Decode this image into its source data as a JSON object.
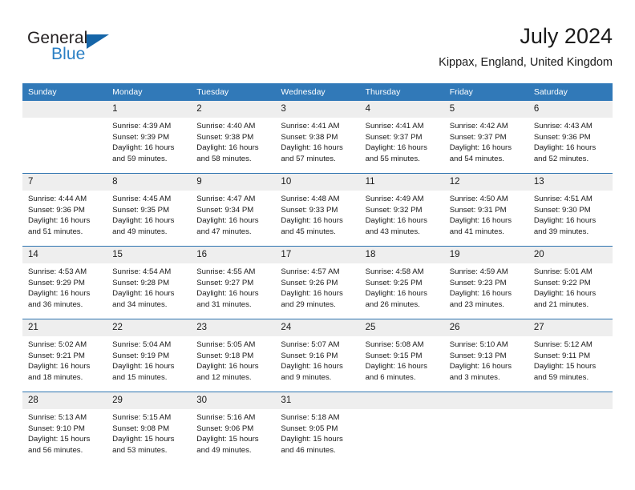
{
  "logo": {
    "word_top": "General",
    "word_bottom": "Blue",
    "triangle_color": "#1565a8",
    "blue_color": "#2a7fc4"
  },
  "header": {
    "title": "July 2024",
    "subtitle": "Kippax, England, United Kingdom"
  },
  "theme": {
    "header_blue": "#3179b8",
    "separator_blue": "#2e74b0",
    "daynum_band": "#eeeeee",
    "text": "#1a1a1a"
  },
  "weekday_headers": [
    "Sunday",
    "Monday",
    "Tuesday",
    "Wednesday",
    "Thursday",
    "Friday",
    "Saturday"
  ],
  "labels": {
    "sunrise": "Sunrise:",
    "sunset": "Sunset:",
    "daylight": "Daylight:"
  },
  "weeks": [
    [
      {
        "day": "",
        "empty": true,
        "sunrise": "",
        "sunset": "",
        "daylight_l1": "",
        "daylight_l2": ""
      },
      {
        "day": "1",
        "sunrise": "Sunrise: 4:39 AM",
        "sunset": "Sunset: 9:39 PM",
        "daylight_l1": "Daylight: 16 hours",
        "daylight_l2": "and 59 minutes."
      },
      {
        "day": "2",
        "sunrise": "Sunrise: 4:40 AM",
        "sunset": "Sunset: 9:38 PM",
        "daylight_l1": "Daylight: 16 hours",
        "daylight_l2": "and 58 minutes."
      },
      {
        "day": "3",
        "sunrise": "Sunrise: 4:41 AM",
        "sunset": "Sunset: 9:38 PM",
        "daylight_l1": "Daylight: 16 hours",
        "daylight_l2": "and 57 minutes."
      },
      {
        "day": "4",
        "sunrise": "Sunrise: 4:41 AM",
        "sunset": "Sunset: 9:37 PM",
        "daylight_l1": "Daylight: 16 hours",
        "daylight_l2": "and 55 minutes."
      },
      {
        "day": "5",
        "sunrise": "Sunrise: 4:42 AM",
        "sunset": "Sunset: 9:37 PM",
        "daylight_l1": "Daylight: 16 hours",
        "daylight_l2": "and 54 minutes."
      },
      {
        "day": "6",
        "sunrise": "Sunrise: 4:43 AM",
        "sunset": "Sunset: 9:36 PM",
        "daylight_l1": "Daylight: 16 hours",
        "daylight_l2": "and 52 minutes."
      }
    ],
    [
      {
        "day": "7",
        "sunrise": "Sunrise: 4:44 AM",
        "sunset": "Sunset: 9:36 PM",
        "daylight_l1": "Daylight: 16 hours",
        "daylight_l2": "and 51 minutes."
      },
      {
        "day": "8",
        "sunrise": "Sunrise: 4:45 AM",
        "sunset": "Sunset: 9:35 PM",
        "daylight_l1": "Daylight: 16 hours",
        "daylight_l2": "and 49 minutes."
      },
      {
        "day": "9",
        "sunrise": "Sunrise: 4:47 AM",
        "sunset": "Sunset: 9:34 PM",
        "daylight_l1": "Daylight: 16 hours",
        "daylight_l2": "and 47 minutes."
      },
      {
        "day": "10",
        "sunrise": "Sunrise: 4:48 AM",
        "sunset": "Sunset: 9:33 PM",
        "daylight_l1": "Daylight: 16 hours",
        "daylight_l2": "and 45 minutes."
      },
      {
        "day": "11",
        "sunrise": "Sunrise: 4:49 AM",
        "sunset": "Sunset: 9:32 PM",
        "daylight_l1": "Daylight: 16 hours",
        "daylight_l2": "and 43 minutes."
      },
      {
        "day": "12",
        "sunrise": "Sunrise: 4:50 AM",
        "sunset": "Sunset: 9:31 PM",
        "daylight_l1": "Daylight: 16 hours",
        "daylight_l2": "and 41 minutes."
      },
      {
        "day": "13",
        "sunrise": "Sunrise: 4:51 AM",
        "sunset": "Sunset: 9:30 PM",
        "daylight_l1": "Daylight: 16 hours",
        "daylight_l2": "and 39 minutes."
      }
    ],
    [
      {
        "day": "14",
        "sunrise": "Sunrise: 4:53 AM",
        "sunset": "Sunset: 9:29 PM",
        "daylight_l1": "Daylight: 16 hours",
        "daylight_l2": "and 36 minutes."
      },
      {
        "day": "15",
        "sunrise": "Sunrise: 4:54 AM",
        "sunset": "Sunset: 9:28 PM",
        "daylight_l1": "Daylight: 16 hours",
        "daylight_l2": "and 34 minutes."
      },
      {
        "day": "16",
        "sunrise": "Sunrise: 4:55 AM",
        "sunset": "Sunset: 9:27 PM",
        "daylight_l1": "Daylight: 16 hours",
        "daylight_l2": "and 31 minutes."
      },
      {
        "day": "17",
        "sunrise": "Sunrise: 4:57 AM",
        "sunset": "Sunset: 9:26 PM",
        "daylight_l1": "Daylight: 16 hours",
        "daylight_l2": "and 29 minutes."
      },
      {
        "day": "18",
        "sunrise": "Sunrise: 4:58 AM",
        "sunset": "Sunset: 9:25 PM",
        "daylight_l1": "Daylight: 16 hours",
        "daylight_l2": "and 26 minutes."
      },
      {
        "day": "19",
        "sunrise": "Sunrise: 4:59 AM",
        "sunset": "Sunset: 9:23 PM",
        "daylight_l1": "Daylight: 16 hours",
        "daylight_l2": "and 23 minutes."
      },
      {
        "day": "20",
        "sunrise": "Sunrise: 5:01 AM",
        "sunset": "Sunset: 9:22 PM",
        "daylight_l1": "Daylight: 16 hours",
        "daylight_l2": "and 21 minutes."
      }
    ],
    [
      {
        "day": "21",
        "sunrise": "Sunrise: 5:02 AM",
        "sunset": "Sunset: 9:21 PM",
        "daylight_l1": "Daylight: 16 hours",
        "daylight_l2": "and 18 minutes."
      },
      {
        "day": "22",
        "sunrise": "Sunrise: 5:04 AM",
        "sunset": "Sunset: 9:19 PM",
        "daylight_l1": "Daylight: 16 hours",
        "daylight_l2": "and 15 minutes."
      },
      {
        "day": "23",
        "sunrise": "Sunrise: 5:05 AM",
        "sunset": "Sunset: 9:18 PM",
        "daylight_l1": "Daylight: 16 hours",
        "daylight_l2": "and 12 minutes."
      },
      {
        "day": "24",
        "sunrise": "Sunrise: 5:07 AM",
        "sunset": "Sunset: 9:16 PM",
        "daylight_l1": "Daylight: 16 hours",
        "daylight_l2": "and 9 minutes."
      },
      {
        "day": "25",
        "sunrise": "Sunrise: 5:08 AM",
        "sunset": "Sunset: 9:15 PM",
        "daylight_l1": "Daylight: 16 hours",
        "daylight_l2": "and 6 minutes."
      },
      {
        "day": "26",
        "sunrise": "Sunrise: 5:10 AM",
        "sunset": "Sunset: 9:13 PM",
        "daylight_l1": "Daylight: 16 hours",
        "daylight_l2": "and 3 minutes."
      },
      {
        "day": "27",
        "sunrise": "Sunrise: 5:12 AM",
        "sunset": "Sunset: 9:11 PM",
        "daylight_l1": "Daylight: 15 hours",
        "daylight_l2": "and 59 minutes."
      }
    ],
    [
      {
        "day": "28",
        "sunrise": "Sunrise: 5:13 AM",
        "sunset": "Sunset: 9:10 PM",
        "daylight_l1": "Daylight: 15 hours",
        "daylight_l2": "and 56 minutes."
      },
      {
        "day": "29",
        "sunrise": "Sunrise: 5:15 AM",
        "sunset": "Sunset: 9:08 PM",
        "daylight_l1": "Daylight: 15 hours",
        "daylight_l2": "and 53 minutes."
      },
      {
        "day": "30",
        "sunrise": "Sunrise: 5:16 AM",
        "sunset": "Sunset: 9:06 PM",
        "daylight_l1": "Daylight: 15 hours",
        "daylight_l2": "and 49 minutes."
      },
      {
        "day": "31",
        "sunrise": "Sunrise: 5:18 AM",
        "sunset": "Sunset: 9:05 PM",
        "daylight_l1": "Daylight: 15 hours",
        "daylight_l2": "and 46 minutes."
      },
      {
        "day": "",
        "empty": true,
        "sunrise": "",
        "sunset": "",
        "daylight_l1": "",
        "daylight_l2": ""
      },
      {
        "day": "",
        "empty": true,
        "sunrise": "",
        "sunset": "",
        "daylight_l1": "",
        "daylight_l2": ""
      },
      {
        "day": "",
        "empty": true,
        "sunrise": "",
        "sunset": "",
        "daylight_l1": "",
        "daylight_l2": ""
      }
    ]
  ]
}
